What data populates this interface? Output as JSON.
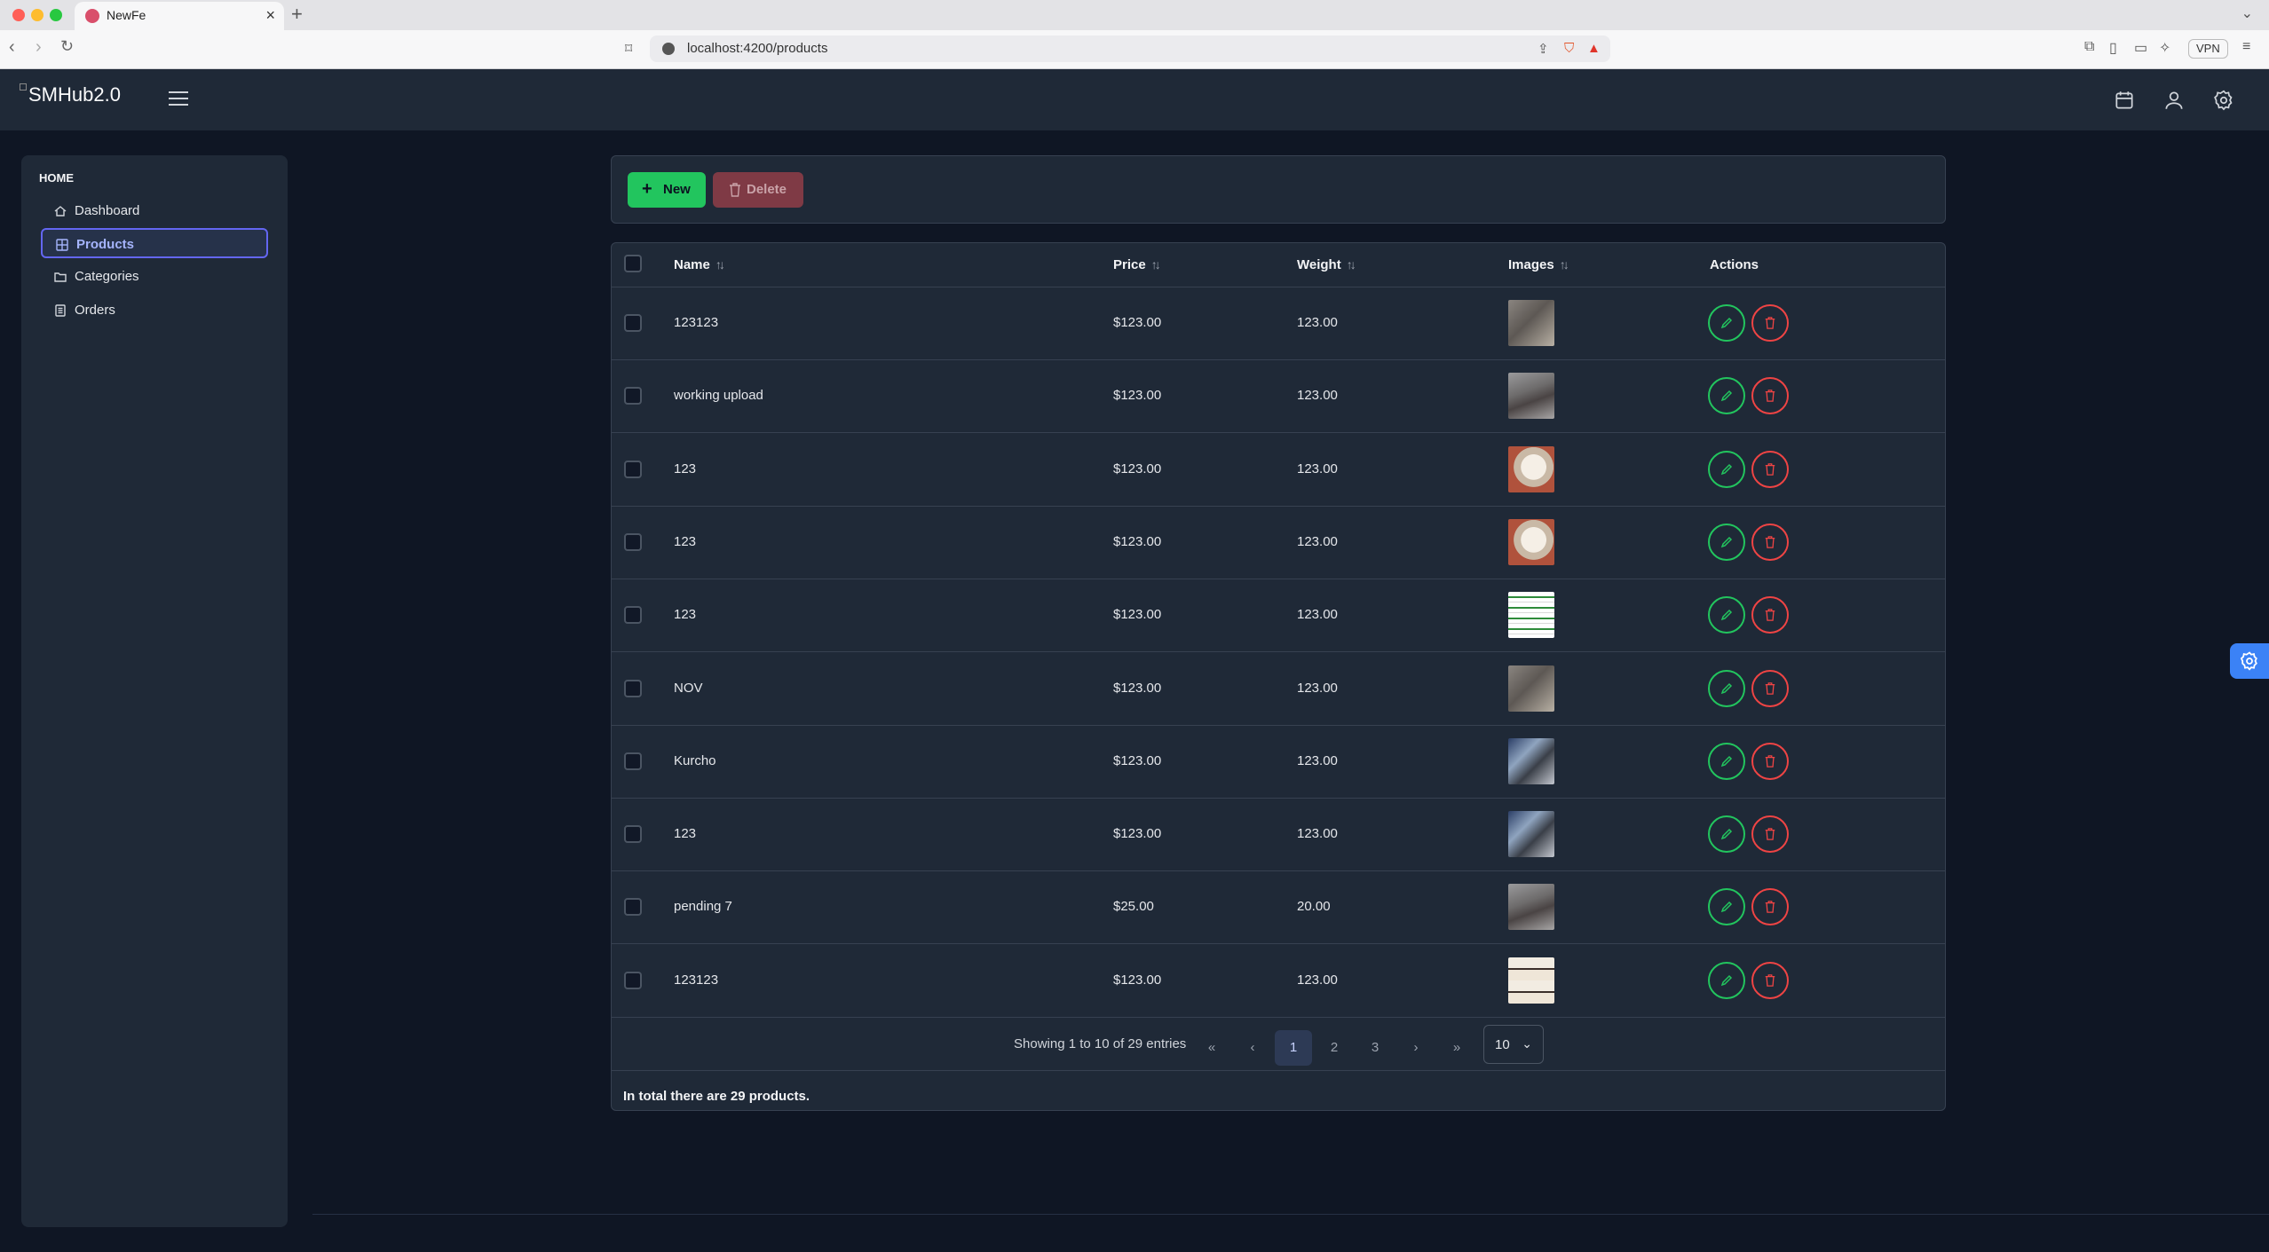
{
  "browser": {
    "tab_title": "NewFe",
    "url": "localhost:4200/products",
    "vpn_label": "VPN"
  },
  "app": {
    "logo_text": "SMHub2.0"
  },
  "sidebar": {
    "section": "HOME",
    "items": [
      {
        "label": "Dashboard",
        "icon": "home-icon"
      },
      {
        "label": "Products",
        "icon": "grid-icon",
        "active": true
      },
      {
        "label": "Categories",
        "icon": "folder-icon"
      },
      {
        "label": "Orders",
        "icon": "receipt-icon"
      }
    ]
  },
  "toolbar": {
    "new_label": "New",
    "delete_label": "Delete"
  },
  "table": {
    "columns": [
      "Name",
      "Price",
      "Weight",
      "Images",
      "Actions"
    ],
    "rows": [
      {
        "name": "123123",
        "price": "$123.00",
        "weight": "123.00",
        "image": "box-photo"
      },
      {
        "name": "working upload",
        "price": "$123.00",
        "weight": "123.00",
        "image": "keyboard-photo"
      },
      {
        "name": "123",
        "price": "$123.00",
        "weight": "123.00",
        "image": "brand-card-photo"
      },
      {
        "name": "123",
        "price": "$123.00",
        "weight": "123.00",
        "image": "brand-card-photo"
      },
      {
        "name": "123",
        "price": "$123.00",
        "weight": "123.00",
        "image": "document-screenshot"
      },
      {
        "name": "NOV",
        "price": "$123.00",
        "weight": "123.00",
        "image": "box-photo"
      },
      {
        "name": "Kurcho",
        "price": "$123.00",
        "weight": "123.00",
        "image": "electronics-photo"
      },
      {
        "name": "123",
        "price": "$123.00",
        "weight": "123.00",
        "image": "electronics-photo"
      },
      {
        "name": "pending 7",
        "price": "$25.00",
        "weight": "20.00",
        "image": "keyboard-photo"
      },
      {
        "name": "123123",
        "price": "$123.00",
        "weight": "123.00",
        "image": "logo-stack-photo"
      }
    ]
  },
  "pagination": {
    "info": "Showing 1 to 10 of 29 entries",
    "first": "«",
    "prev": "‹",
    "pages": [
      "1",
      "2",
      "3"
    ],
    "current": "1",
    "next": "›",
    "last": "»",
    "page_size": "10"
  },
  "footer": {
    "total_text": "In total there are 29 products."
  },
  "colors": {
    "accent_green": "#22c55e",
    "accent_red": "#ef4444",
    "accent_indigo": "#6366f1"
  }
}
